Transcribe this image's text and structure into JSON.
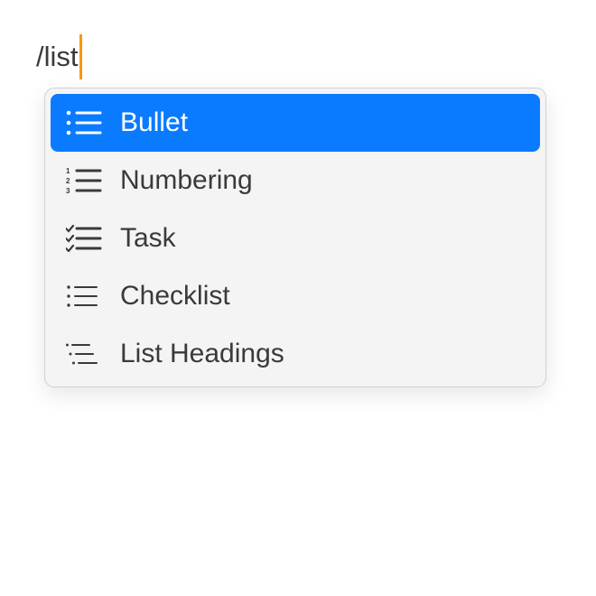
{
  "editor": {
    "text": "/list"
  },
  "menu": {
    "items": [
      {
        "label": "Bullet",
        "icon": "bullet-list-icon",
        "selected": true
      },
      {
        "label": "Numbering",
        "icon": "numbered-list-icon",
        "selected": false
      },
      {
        "label": "Task",
        "icon": "task-list-icon",
        "selected": false
      },
      {
        "label": "Checklist",
        "icon": "checklist-icon",
        "selected": false
      },
      {
        "label": "List Headings",
        "icon": "list-headings-icon",
        "selected": false
      }
    ]
  },
  "colors": {
    "accent": "#0a7bff",
    "caret": "#f59a0c"
  }
}
